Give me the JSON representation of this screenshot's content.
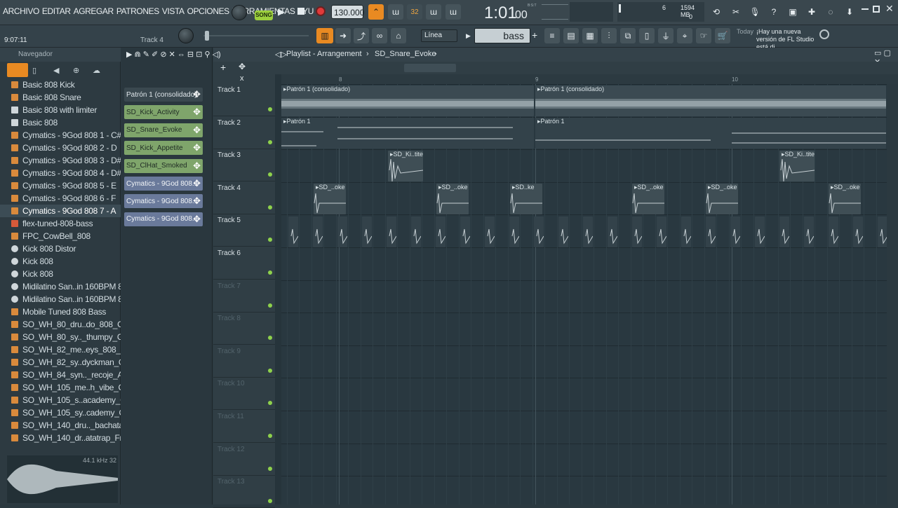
{
  "menu": [
    "ARCHIVO",
    "EDITAR",
    "AGREGAR",
    "PATRONES",
    "VISTA",
    "OPCIONES",
    "HERRAMIENTAS",
    "AYU"
  ],
  "transport": {
    "mode": "SONG",
    "tempo": "130.000",
    "time": "1:01",
    "time_sub": "00",
    "time_label": "B:S:T",
    "memory": "1594 MB",
    "cpu": "6",
    "poly": "0",
    "counter": "32"
  },
  "hint": {
    "time": "9:07:11",
    "track": "Track 4",
    "snap": "Línea",
    "search": "bass",
    "news_prefix": "Today",
    "news": "¡Hay una nueva versión de FL Studio está di..."
  },
  "browser": {
    "title": "Navegador",
    "items": [
      {
        "label": "Basic 808 Kick",
        "icon": "folder"
      },
      {
        "label": "Basic 808 Snare",
        "icon": "folder"
      },
      {
        "label": "Basic 808 with limiter",
        "icon": "file"
      },
      {
        "label": "Basic 808",
        "icon": "file"
      },
      {
        "label": "Cymatics - 9God 808 1 - C#",
        "icon": "folder"
      },
      {
        "label": "Cymatics - 9God 808 2 - D",
        "icon": "folder"
      },
      {
        "label": "Cymatics - 9God 808 3 - D#",
        "icon": "folder"
      },
      {
        "label": "Cymatics - 9God 808 4 - D#",
        "icon": "folder"
      },
      {
        "label": "Cymatics - 9God 808 5 - E",
        "icon": "folder"
      },
      {
        "label": "Cymatics - 9God 808 6 - F",
        "icon": "folder"
      },
      {
        "label": "Cymatics - 9God 808 7 - A",
        "icon": "folder",
        "selected": true
      },
      {
        "label": "flex-tuned-808-bass",
        "icon": "plugin"
      },
      {
        "label": "FPC_CowBell_808",
        "icon": "folder"
      },
      {
        "label": "Kick 808 Distor",
        "icon": "gear"
      },
      {
        "label": "Kick 808",
        "icon": "gear"
      },
      {
        "label": "Kick 808",
        "icon": "gear"
      },
      {
        "label": "Midilatino San..in 160BPM 808",
        "icon": "midi"
      },
      {
        "label": "Midilatino San..in 160BPM 808",
        "icon": "midi"
      },
      {
        "label": "Mobile Tuned 808 Bass",
        "icon": "folder"
      },
      {
        "label": "SO_WH_80_dru..do_808_Gmin",
        "icon": "folder"
      },
      {
        "label": "SO_WH_80_sy.._thumpy_Gmin",
        "icon": "folder"
      },
      {
        "label": "SO_WH_82_me..eys_808_Gmin",
        "icon": "folder"
      },
      {
        "label": "SO_WH_82_sy..dyckman_Gmin",
        "icon": "folder"
      },
      {
        "label": "SO_WH_84_syn.._recoje_Amin",
        "icon": "folder"
      },
      {
        "label": "SO_WH_105_me..h_vibe_Cmin",
        "icon": "folder"
      },
      {
        "label": "SO_WH_105_s..academy_Cmin",
        "icon": "folder"
      },
      {
        "label": "SO_WH_105_sy..cademy_Cmin",
        "icon": "folder"
      },
      {
        "label": "SO_WH_140_dru.._bachatatrap",
        "icon": "folder"
      },
      {
        "label": "SO_WH_140_dr..atatrap_Fmin",
        "icon": "folder"
      }
    ],
    "preview_info": "44.1 kHz 32"
  },
  "channels": [
    {
      "label": "Patrón 1 (consolidado)",
      "color": "#3a484f"
    },
    {
      "label": "SD_Kick_Activity",
      "color": "#7fa56b"
    },
    {
      "label": "SD_Snare_Evoke",
      "color": "#7fa56b"
    },
    {
      "label": "SD_Kick_Appetite",
      "color": "#7fa56b"
    },
    {
      "label": "SD_ClHat_Smoked",
      "color": "#7fa56b"
    },
    {
      "label": "Cymatics - 9God 808..",
      "color": "#6a7a9b"
    },
    {
      "label": "Cymatics - 9God 808..",
      "color": "#6a7a9b"
    },
    {
      "label": "Cymatics - 9God 808..",
      "color": "#6a7a9b"
    }
  ],
  "playlist": {
    "title": "Playlist - Arrangement",
    "pattern": "SD_Snare_Evoke",
    "ruler": [
      "8",
      "9",
      "10"
    ],
    "tracks": [
      "Track 1",
      "Track 2",
      "Track 3",
      "Track 4",
      "Track 5",
      "Track 6",
      "Track 7",
      "Track 8",
      "Track 9",
      "Track 10",
      "Track 11",
      "Track 12",
      "Track 13"
    ],
    "clips": {
      "t1": "Patrón 1 (consolidado)",
      "t2": "Patrón 1",
      "t3": "SD_Ki..tite",
      "t4a": "SD_..oke",
      "t4b": "SD..ke"
    }
  }
}
